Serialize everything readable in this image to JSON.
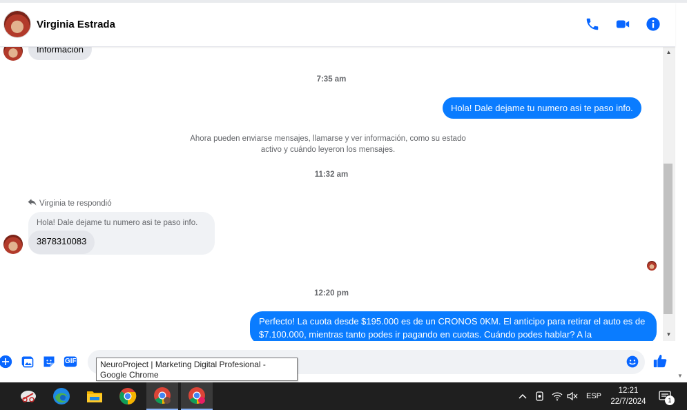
{
  "header": {
    "contact_name": "Virginia Estrada"
  },
  "messages": {
    "top_partial": "Información",
    "time1": "7:35 am",
    "out1": "Hola! Dale dejame tu numero  asi te paso info.",
    "system_line1": "Ahora pueden enviarse mensajes, llamarse y ver información, como su estado",
    "system_line2": "activo y cuándo leyeron los mensajes.",
    "time2": "11:32 am",
    "reply_header": "Virginia te respondió",
    "reply_quoted": "Hola! Dale dejame tu numero  asi te paso info.",
    "in_phone": "3878310083",
    "time3": "12:20 pm",
    "out2": "Perfecto! La cuota desde $195.000 es de un CRONOS 0KM. El anticipo para retirar el auto es de $7.100.000, mientras tanto podes ir pagando en cuotas. Cuándo podes hablar? A la"
  },
  "composer": {
    "tooltip_text": "NeuroProject | Marketing Digital Profesional - Google Chrome",
    "gif_label": "GIF"
  },
  "taskbar": {
    "language": "ESP",
    "time": "12:21",
    "date": "22/7/2024",
    "notifications": "1"
  },
  "colors": {
    "accent": "#0a7cff",
    "icon_blue": "#0866ff",
    "taskbar": "#1f1f1f"
  }
}
